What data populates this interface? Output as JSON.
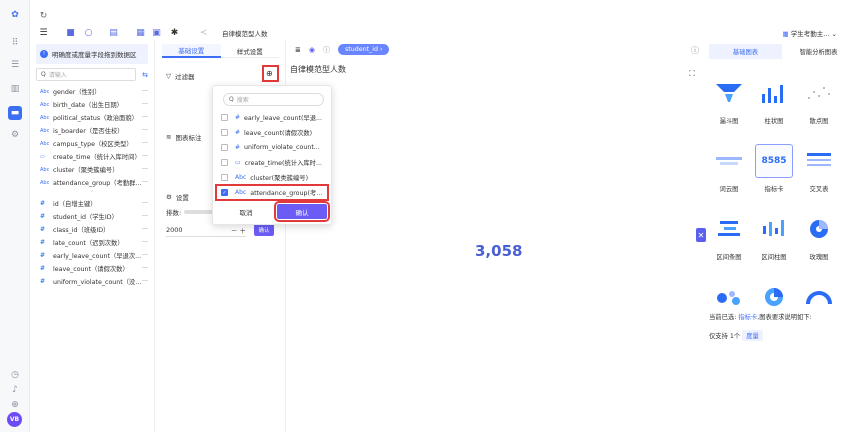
{
  "topbar": {
    "title": "自律模范型人数",
    "right_label": "学生考勤主..."
  },
  "fields_panel": {
    "header": "明确度或度量字段拖到数据区",
    "search_placeholder": "请输入",
    "dimension_fields": [
      {
        "type": "Abc",
        "label": "gender（性别）"
      },
      {
        "type": "Abc",
        "label": "birth_date（出生日期）"
      },
      {
        "type": "Abc",
        "label": "political_status（政治面貌）"
      },
      {
        "type": "Abc",
        "label": "is_boarder（是否住校）"
      },
      {
        "type": "Abc",
        "label": "campus_type（校区类型）"
      },
      {
        "type": "cal",
        "label": "create_time（统计入库时间）"
      },
      {
        "type": "Abc",
        "label": "cluster（聚类簇编号）"
      },
      {
        "type": "Abc",
        "label": "attendance_group（考勤群..."
      }
    ],
    "measure_fields": [
      {
        "type": "#",
        "label": "id（自增主键）"
      },
      {
        "type": "#",
        "label": "student_id（学生ID）"
      },
      {
        "type": "#",
        "label": "class_id（班级ID）"
      },
      {
        "type": "#",
        "label": "late_count（迟到次数）"
      },
      {
        "type": "#",
        "label": "early_leave_count（早退次..."
      },
      {
        "type": "#",
        "label": "leave_count（请假次数）"
      },
      {
        "type": "#",
        "label": "uniform_violate_count（没..."
      }
    ]
  },
  "config_panel": {
    "tabs": [
      "基础设置",
      "样式设置"
    ],
    "filter_label": "过滤器",
    "chart_label": "图表标注",
    "settings_label": "设置",
    "sort_label": "排数:",
    "limit_value": "2000",
    "confirm_label": "确认"
  },
  "canvas": {
    "field_pill": "student_id",
    "chart_title": "自律模范型人数",
    "value": "3,058"
  },
  "popup": {
    "search_placeholder": "搜索",
    "items": [
      {
        "type": "#",
        "label": "early_leave_count(早退...",
        "checked": false
      },
      {
        "type": "#",
        "label": "leave_count(请假次数)",
        "checked": false
      },
      {
        "type": "#",
        "label": "uniform_violate_count...",
        "checked": false
      },
      {
        "type": "cal",
        "label": "create_time(统计入库时...",
        "checked": false
      },
      {
        "type": "Abc",
        "label": "cluster(聚类簇编号)",
        "checked": false
      },
      {
        "type": "Abc",
        "label": "attendance_group(考...",
        "checked": true
      }
    ],
    "cancel_label": "取消",
    "ok_label": "确认"
  },
  "types_panel": {
    "tabs": [
      "基础图表",
      "智能分析图表"
    ],
    "types": [
      {
        "label": "漏斗图",
        "icon": "funnel-icon"
      },
      {
        "label": "柱状图",
        "icon": "bar-chart-icon"
      },
      {
        "label": "散点图",
        "icon": "scatter-icon"
      },
      {
        "label": "词云图",
        "icon": "wordcloud-icon"
      },
      {
        "label": "指标卡",
        "icon": "metric-card-icon"
      },
      {
        "label": "交叉表",
        "icon": "crosstab-icon"
      },
      {
        "label": "区间条图",
        "icon": "range-bar-icon"
      },
      {
        "label": "区间柱图",
        "icon": "range-column-icon"
      },
      {
        "label": "玫瑰图",
        "icon": "rose-icon"
      },
      {
        "label": "",
        "icon": "bubble-icon"
      },
      {
        "label": "",
        "icon": "pie-icon"
      },
      {
        "label": "",
        "icon": "gauge-icon"
      }
    ],
    "metric_card_value": "8585",
    "current_label": "当前已选:",
    "current_link": "指标卡",
    "current_suffix": ",图表要求说明如下:",
    "support_text": "仅支持 1个",
    "support_tag": "度量"
  },
  "colors": {
    "accent": "#3d6ff5",
    "button": "#6a5cf5",
    "highlight": "#e23a3a",
    "number": "#4a5fd3"
  }
}
